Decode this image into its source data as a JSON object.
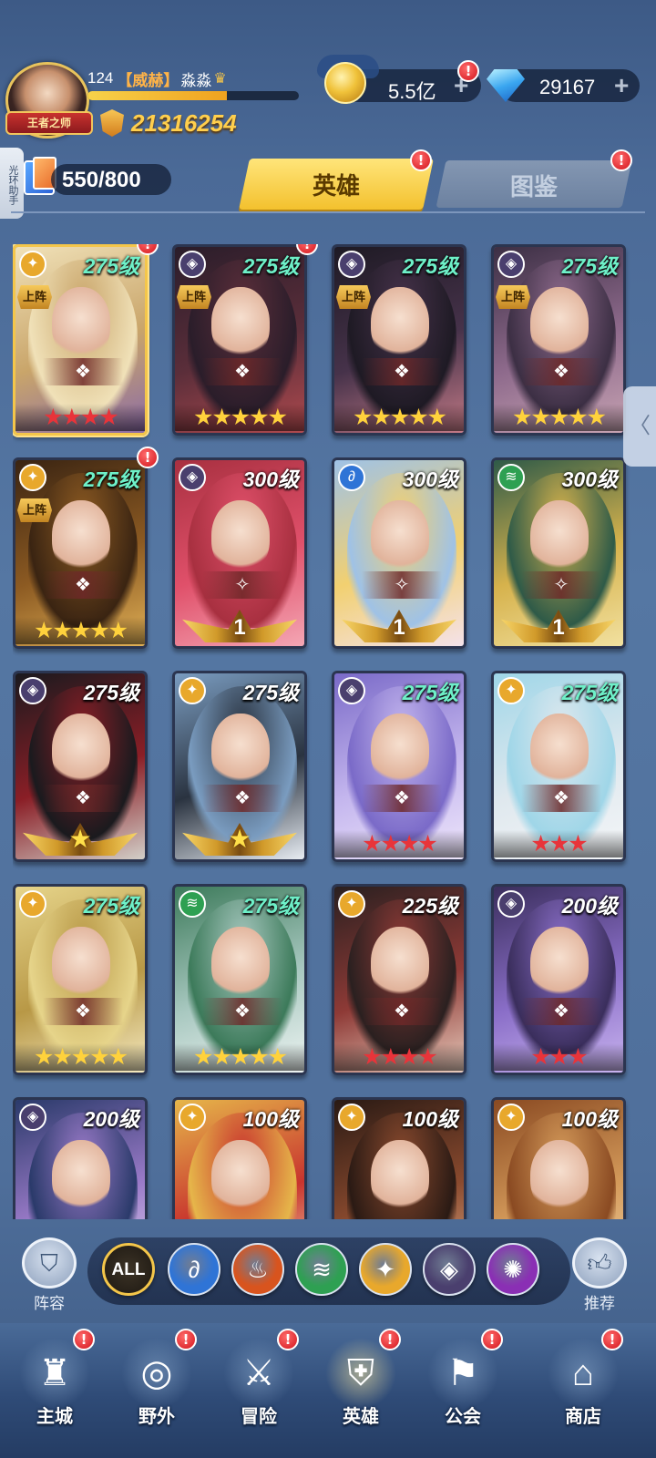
{
  "player": {
    "level": "124",
    "guild": "【威赫】",
    "name": "淼淼",
    "title_badge": "王者之师",
    "exp_progress": 0.66,
    "power": "21316254"
  },
  "currency": {
    "gold": "5.5亿",
    "diamonds": "29167",
    "plus": "+"
  },
  "side_tab": "光环助手",
  "hero_count": "550/800",
  "tabs": {
    "heroes": "英雄",
    "codex": "图鉴"
  },
  "badge_mark": "!",
  "onteam_label": "上阵",
  "heroes": [
    {
      "level": "275级",
      "faction": "light",
      "stars": "★★★★",
      "star_color": "red",
      "on_team": true,
      "badge": true,
      "selected": true,
      "art": [
        "#f0e1b8",
        "#c9a56a",
        "#8a6aa8"
      ]
    },
    {
      "level": "275级",
      "faction": "dark",
      "stars": "★★★★★",
      "star_color": "gold",
      "on_team": true,
      "badge": true,
      "selected": false,
      "art": [
        "#2a1d2a",
        "#5b2e3a",
        "#b04a4e"
      ]
    },
    {
      "level": "275级",
      "faction": "dark",
      "stars": "★★★★★",
      "star_color": "gold",
      "on_team": true,
      "badge": false,
      "selected": false,
      "art": [
        "#1e1a24",
        "#46324a",
        "#c37a86"
      ]
    },
    {
      "level": "275级",
      "faction": "dark",
      "stars": "★★★★★",
      "star_color": "gold",
      "on_team": true,
      "badge": false,
      "selected": false,
      "art": [
        "#3c2f44",
        "#8e6a8c",
        "#c7a3b2"
      ]
    },
    {
      "level": "275级",
      "faction": "light",
      "stars": "★★★★★",
      "star_color": "gold",
      "on_team": true,
      "badge": true,
      "selected": false,
      "art": [
        "#3a2412",
        "#8c5a22",
        "#e0b056"
      ]
    },
    {
      "level": "300级",
      "faction": "dark",
      "wing": "1",
      "on_team": false,
      "badge": false,
      "selected": false,
      "art": [
        "#a83040",
        "#e0506a",
        "#f4a6b4"
      ]
    },
    {
      "level": "300级",
      "faction": "water",
      "wing": "1",
      "on_team": false,
      "badge": false,
      "selected": false,
      "art": [
        "#9fc2e6",
        "#f2d070",
        "#f4e2ea"
      ]
    },
    {
      "level": "300级",
      "faction": "wind",
      "wing": "1",
      "on_team": false,
      "badge": false,
      "selected": false,
      "art": [
        "#2e5a48",
        "#d6b24c",
        "#f2e1a0"
      ]
    },
    {
      "level": "275级",
      "faction": "dark",
      "wing_star": "★",
      "on_team": false,
      "badge": false,
      "selected": false,
      "art": [
        "#1a1a1e",
        "#8a1e26",
        "#d2cfc8"
      ]
    },
    {
      "level": "275级",
      "faction": "light",
      "wing_star": "★",
      "on_team": false,
      "badge": false,
      "selected": false,
      "art": [
        "#7a9cc0",
        "#2a3340",
        "#e7ecf2"
      ]
    },
    {
      "level": "275级",
      "faction": "dark",
      "stars": "★★★★",
      "star_color": "red",
      "on_team": false,
      "badge": false,
      "selected": false,
      "art": [
        "#7a6ac8",
        "#c4b6ee",
        "#eee6fb"
      ]
    },
    {
      "level": "275级",
      "faction": "light",
      "stars": "★★★",
      "star_color": "red",
      "on_team": false,
      "badge": false,
      "selected": false,
      "art": [
        "#9fd6e8",
        "#dfe8ee",
        "#f4f6f8"
      ]
    },
    {
      "level": "275级",
      "faction": "light",
      "stars": "★★★★★",
      "star_color": "gold",
      "on_team": false,
      "badge": false,
      "selected": false,
      "art": [
        "#e6d48a",
        "#b89846",
        "#f5eac0"
      ]
    },
    {
      "level": "275级",
      "faction": "wind",
      "stars": "★★★★★",
      "star_color": "gold",
      "on_team": false,
      "badge": false,
      "selected": false,
      "art": [
        "#3c7a5a",
        "#a8c8c0",
        "#eef4f2"
      ]
    },
    {
      "level": "225级",
      "faction": "light",
      "stars": "★★★★",
      "star_color": "red",
      "on_team": false,
      "badge": false,
      "selected": false,
      "art": [
        "#2a2020",
        "#8e3a36",
        "#e8cbbc"
      ]
    },
    {
      "level": "200级",
      "faction": "dark",
      "stars": "★★★",
      "star_color": "red",
      "on_team": false,
      "badge": false,
      "selected": false,
      "art": [
        "#3a2e5c",
        "#8a6ec8",
        "#c9b4ef"
      ]
    },
    {
      "level": "200级",
      "faction": "dark",
      "on_team": false,
      "badge": false,
      "selected": false,
      "art": [
        "#2a3a6a",
        "#9a7ac8",
        "#e3d8f2"
      ]
    },
    {
      "level": "100级",
      "faction": "light",
      "on_team": false,
      "badge": false,
      "selected": false,
      "art": [
        "#e6b64a",
        "#c8342e",
        "#f6dcb0"
      ]
    },
    {
      "level": "100级",
      "faction": "light",
      "on_team": false,
      "badge": false,
      "selected": false,
      "art": [
        "#2a1a14",
        "#8a4a2e",
        "#e4b08a"
      ]
    },
    {
      "level": "100级",
      "faction": "light",
      "on_team": false,
      "badge": false,
      "selected": false,
      "art": [
        "#8a4a22",
        "#d49a5a",
        "#f2d4a6"
      ]
    }
  ],
  "faction_icons": {
    "light": {
      "glyph": "✦",
      "color": "#e8a82c"
    },
    "dark": {
      "glyph": "◈",
      "color": "#4a3f6e"
    },
    "water": {
      "glyph": "∂",
      "color": "#2f74d6"
    },
    "wind": {
      "glyph": "≋",
      "color": "#2ea052"
    }
  },
  "filters": {
    "lineup_label": "阵容",
    "recommend_label": "推荐",
    "all_label": "ALL",
    "items": [
      {
        "name": "water",
        "glyph": "∂",
        "color": "#2f74d6"
      },
      {
        "name": "fire",
        "glyph": "♨",
        "color": "#d8541e"
      },
      {
        "name": "wind",
        "glyph": "≋",
        "color": "#2ea052"
      },
      {
        "name": "light",
        "glyph": "✦",
        "color": "#e8a82c"
      },
      {
        "name": "dark",
        "glyph": "◈",
        "color": "#4a3f6e"
      },
      {
        "name": "arcane",
        "glyph": "✺",
        "color": "#8a2fb4"
      }
    ]
  },
  "nav": [
    {
      "label": "主城",
      "icon": "castle-icon",
      "glyph": "♜",
      "badge": true,
      "active": false
    },
    {
      "label": "野外",
      "icon": "portal-icon",
      "glyph": "◎",
      "badge": true,
      "active": false
    },
    {
      "label": "冒险",
      "icon": "trident-icon",
      "glyph": "⚔",
      "badge": true,
      "active": false
    },
    {
      "label": "英雄",
      "icon": "helmet-icon",
      "glyph": "⛨",
      "badge": true,
      "active": true
    },
    {
      "label": "公会",
      "icon": "banner-icon",
      "glyph": "⚑",
      "badge": true,
      "active": false
    },
    {
      "label": "商店",
      "icon": "shop-icon",
      "glyph": "⌂",
      "badge": true,
      "active": false
    }
  ]
}
